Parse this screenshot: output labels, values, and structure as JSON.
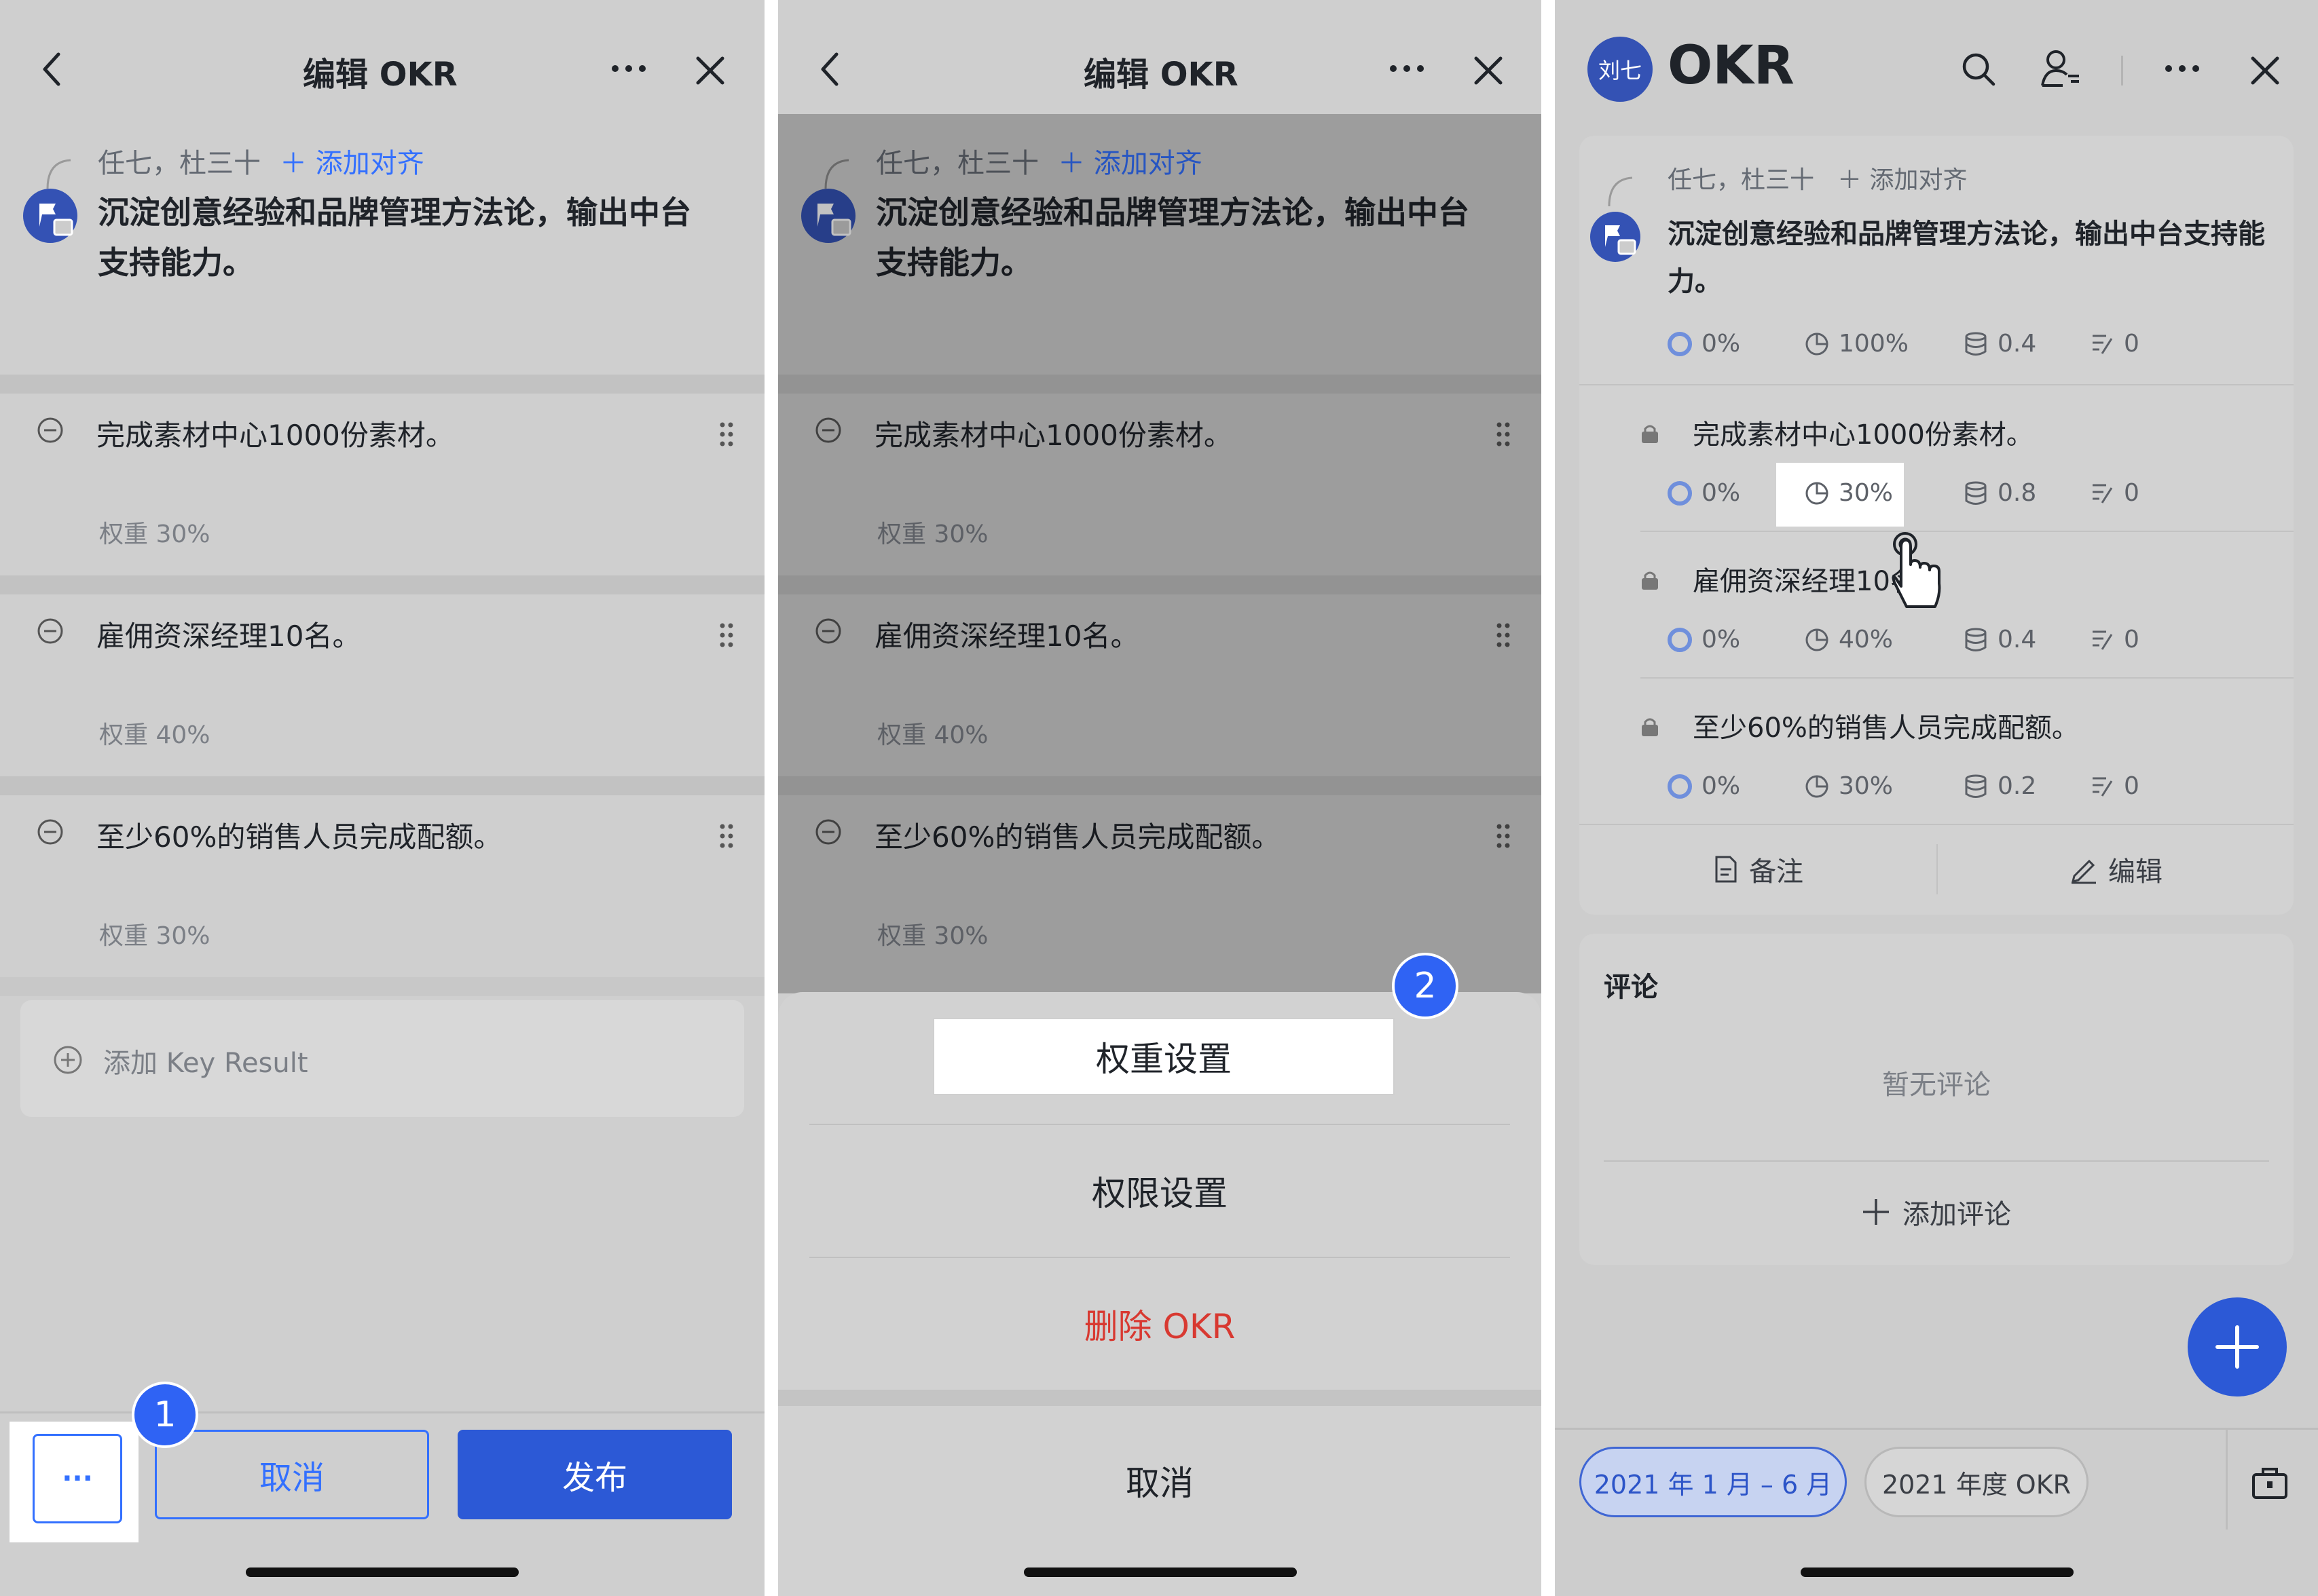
{
  "panel1": {
    "header": {
      "title": "编辑 OKR"
    },
    "objective": {
      "assignees": "任七，杜三十",
      "align_link": "添加对齐",
      "text": "沉淀创意经验和品牌管理方法论，输出中台支持能力。"
    },
    "key_results": [
      {
        "text": "完成素材中心1000份素材。",
        "weight": "权重 30%"
      },
      {
        "text": "雇佣资深经理10名。",
        "weight": "权重 40%"
      },
      {
        "text": "至少60%的销售人员完成配额。",
        "weight": "权重 30%"
      }
    ],
    "add_kr_label": "添加 Key Result",
    "bottom": {
      "more_label": "···",
      "cancel_label": "取消",
      "publish_label": "发布"
    },
    "step_badge": "1"
  },
  "panel2": {
    "header": {
      "title": "编辑 OKR"
    },
    "objective": {
      "assignees": "任七，杜三十",
      "align_link": "添加对齐",
      "text": "沉淀创意经验和品牌管理方法论，输出中台支持能力。"
    },
    "key_results": [
      {
        "text": "完成素材中心1000份素材。",
        "weight": "权重 30%"
      },
      {
        "text": "雇佣资深经理10名。",
        "weight": "权重 40%"
      },
      {
        "text": "至少60%的销售人员完成配额。",
        "weight": "权重 30%"
      }
    ],
    "sheet": {
      "weight_settings": "权重设置",
      "permission_settings": "权限设置",
      "delete_okr": "删除 OKR",
      "cancel": "取消"
    },
    "step_badge": "2"
  },
  "panel3": {
    "header": {
      "avatar_text": "刘七",
      "title": "OKR"
    },
    "objective": {
      "assignees": "任七，杜三十",
      "align_link": "添加对齐",
      "text": "沉淀创意经验和品牌管理方法论，输出中台支持能力。",
      "metrics": {
        "progress": "0%",
        "weight": "100%",
        "score": "0.4",
        "notes": "0"
      }
    },
    "key_results": [
      {
        "text": "完成素材中心1000份素材。",
        "progress": "0%",
        "weight": "30%",
        "score": "0.8",
        "notes": "0"
      },
      {
        "text": "雇佣资深经理10名。",
        "progress": "0%",
        "weight": "40%",
        "score": "0.4",
        "notes": "0"
      },
      {
        "text": "至少60%的销售人员完成配额。",
        "progress": "0%",
        "weight": "30%",
        "score": "0.2",
        "notes": "0"
      }
    ],
    "actions": {
      "notes_label": "备注",
      "edit_label": "编辑"
    },
    "comments": {
      "title": "评论",
      "empty": "暂无评论",
      "add_label": "添加评论"
    },
    "periods": [
      "2021 年 1 月 – 6 月",
      "2021 年度 OKR"
    ]
  },
  "colors": {
    "accent": "#3370ff",
    "danger": "#d83931",
    "badge": "#2f63f4",
    "avatar": "#3452b4"
  }
}
